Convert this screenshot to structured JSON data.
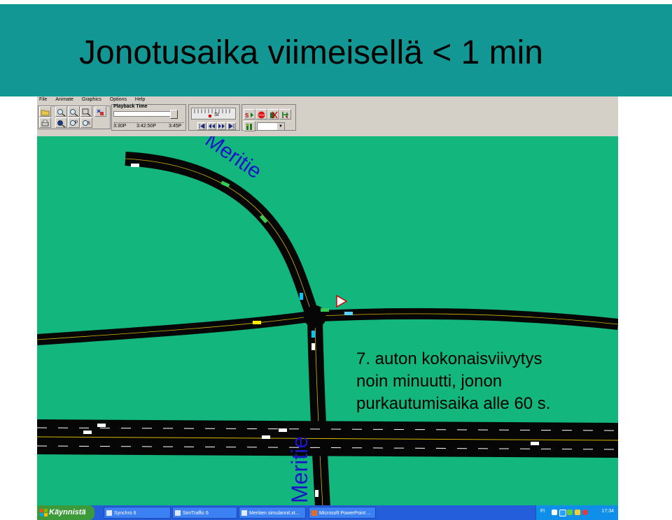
{
  "slide": {
    "title": "Jonotusaika viimeisellä < 1 min",
    "caption_lines": [
      "7. auton kokonaisviivytys",
      "noin minuutti, jonon",
      "purkautumisaika alle 60 s."
    ]
  },
  "menu": [
    "File",
    "Animate",
    "Graphics",
    "Options",
    "Help"
  ],
  "toolbar": {
    "playback_label": "Playback Time",
    "time_marks": [
      "3:30P",
      "3:42:50P",
      "3:45P"
    ],
    "lcd_text": "St",
    "stop_text": "STOP",
    "record_text": "S"
  },
  "map": {
    "road_labels": [
      "Meritie",
      "Meritie"
    ],
    "road_color": "#060606",
    "ground_color": "#13b67c",
    "label_color": "#1a16c8"
  },
  "taskbar": {
    "start_label": "Käynnistä",
    "items": [
      "Synchro 6",
      "SimTraffic 6",
      "Meritien simulannit.xt...",
      "Microsoft PowerPoint ..."
    ],
    "lang": "FI",
    "clock": "17:34"
  },
  "colors": {
    "title_band": "#139794",
    "taskbar": "#245edb",
    "start_button": "#3c9a3a"
  }
}
